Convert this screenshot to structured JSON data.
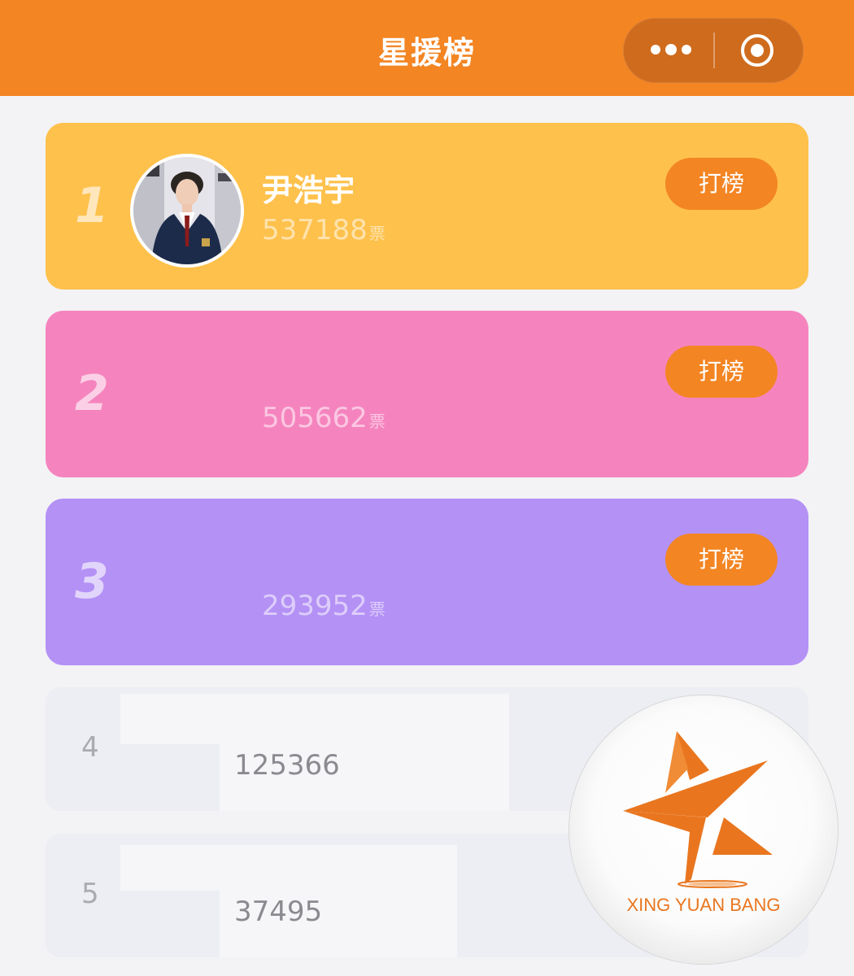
{
  "header": {
    "title": "星援榜"
  },
  "capsule": {
    "more_icon": "more-dots-icon",
    "close_icon": "target-close-icon"
  },
  "top_cards": [
    {
      "rank": "1",
      "name": "尹浩宇",
      "votes": "537188",
      "unit": "票",
      "button": "打榜",
      "color": "#fec14c"
    },
    {
      "rank": "2",
      "name": "",
      "votes": "505662",
      "unit": "票",
      "button": "打榜",
      "color": "#f584be"
    },
    {
      "rank": "3",
      "name": "",
      "votes": "293952",
      "unit": "票",
      "button": "打榜",
      "color": "#b491f5"
    }
  ],
  "rows": [
    {
      "rank": "4",
      "votes": "125366"
    },
    {
      "rank": "5",
      "votes": "37495"
    }
  ],
  "watermark": {
    "text": "XING YUAN BANG",
    "accent": "#e9761f"
  },
  "colors": {
    "header": "#f38523",
    "button": "#f38523",
    "background": "#f3f3f6"
  }
}
